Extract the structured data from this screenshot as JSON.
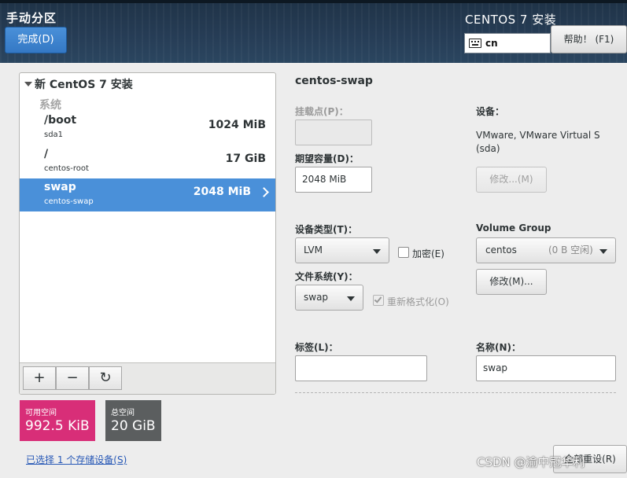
{
  "header": {
    "page_title": "手动分区",
    "done_button": "完成(D)",
    "product_title": "CENTOS 7 安装",
    "keyboard_layout": "cn",
    "help_button": "帮助！ (F1)"
  },
  "tree": {
    "install_title": "新 CentOS 7 安装",
    "group_label": "系统",
    "mounts": [
      {
        "mount": "/boot",
        "device": "sda1",
        "size": "1024 MiB"
      },
      {
        "mount": "/",
        "device": "centos-root",
        "size": "17 GiB"
      },
      {
        "mount": "swap",
        "device": "centos-swap",
        "size": "2048 MiB"
      }
    ],
    "toolbar": {
      "add": "+",
      "remove": "−",
      "refresh": "↻"
    }
  },
  "space": {
    "available_label": "可用空间",
    "available_value": "992.5 KiB",
    "total_label": "总空间",
    "total_value": "20 GiB"
  },
  "storage_link": "已选择 1 个存储设备(S)",
  "detail": {
    "title": "centos-swap",
    "mount_point_label": "挂载点(P)：",
    "mount_point_value": "",
    "capacity_label": "期望容量(D)：",
    "capacity_value": "2048 MiB",
    "device_label": "设备：",
    "device_value_line1": "VMware, VMware Virtual S",
    "device_value_line2": "(sda)",
    "modify_device_button": "修改...(M)",
    "device_type_label": "设备类型(T)：",
    "device_type_value": "LVM",
    "encrypt_label": "加密(E)",
    "filesystem_label": "文件系统(Y)：",
    "filesystem_value": "swap",
    "reformat_label": "重新格式化(O)",
    "volume_group_label": "Volume Group",
    "volume_group_name": "centos",
    "volume_group_free": "(0 B 空闲)",
    "modify_vg_button": "修改(M)...",
    "tag_label": "标签(L)：",
    "tag_value": "",
    "name_label": "名称(N)：",
    "name_value": "swap",
    "reset_button": "全部重设(R)"
  },
  "watermark": "CSDN @渝中冠华利",
  "colors": {
    "header_bg": "#263c55",
    "accent": "#4a90d9",
    "available_space": "#d82e78",
    "total_space": "#5b5e5f",
    "link": "#2758b6"
  },
  "icons": {
    "keyboard": "keyboard-icon",
    "expand": "triangle-down-icon",
    "selected_row": "chevron-right-icon",
    "refresh": "refresh-icon"
  }
}
